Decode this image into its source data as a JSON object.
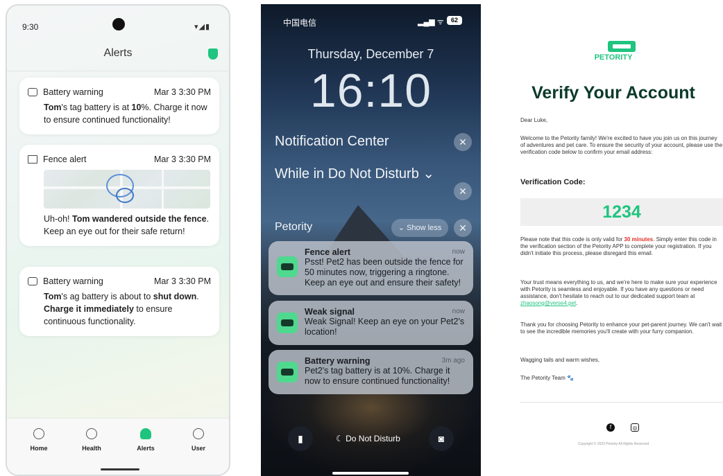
{
  "android": {
    "time": "9:30",
    "title": "Alerts",
    "cards": [
      {
        "title": "Battery warning",
        "date": "Mar 3 3:30 PM",
        "body_html": "<b>Tom</b>'s tag battery is at <b>10</b>%. Charge it now to ensure continued functionality!"
      },
      {
        "title": "Fence alert",
        "date": "Mar 3 3:30 PM",
        "body_html": "Uh-oh! <b>Tom wandered outside the fence</b>. Keep an eye out for their safe return!"
      },
      {
        "title": "Battery warning",
        "date": "Mar 3 3:30 PM",
        "body_html": "<b>Tom</b>'s ag battery is about to <b>shut down</b>. <b>Charge it immediately</b> to ensure continuous functionality."
      }
    ],
    "nav": [
      {
        "label": "Home",
        "icon": "home-icon",
        "active": false
      },
      {
        "label": "Health",
        "icon": "health-icon",
        "active": false
      },
      {
        "label": "Alerts",
        "icon": "bell-icon",
        "active": true
      },
      {
        "label": "User",
        "icon": "user-icon",
        "active": false
      }
    ],
    "accent": "#1fc47f"
  },
  "ios": {
    "carrier": "中国电信",
    "battery": "62",
    "date": "Thursday, December 7",
    "clock": "16:10",
    "notification_center": "Notification Center",
    "dnd_header": "While in Do Not Disturb",
    "app_name": "Petority",
    "show_less": "Show less",
    "notifications": [
      {
        "title": "Fence alert",
        "when": "now",
        "body": "Psst! Pet2 has been outside the fence for 50 minutes now, triggering a ringtone. Keep an eye out and ensure their safety!"
      },
      {
        "title": "Weak signal",
        "when": "now",
        "body": "Weak Signal! Keep an eye on your Pet2's location!"
      },
      {
        "title": "Battery warning",
        "when": "3m ago",
        "body": "Pet2's tag battery is at 10%. Charge it now to ensure continued functionality!"
      }
    ],
    "dnd_label": "Do Not Disturb"
  },
  "email": {
    "brand": "PETORITY",
    "heading": "Verify Your Account",
    "greeting": "Dear Luke,",
    "intro": "Welcome to the Petority family! We're excited to have you join us on this journey of adventures and pet care. To ensure the security of your account, please use the verification code below to confirm your email address:",
    "code_label": "Verification Code:",
    "code": "1234",
    "note_pre": "Please note that this code is only valid for ",
    "note_red": "30 minutes",
    "note_post": ". Simply enter this code in the verification section of the Petority APP to complete your registration. If you didn't initiate this process, please disregard this email.",
    "trust_pre": "Your trust means everything to us, and we're here to make sure your experience with Petority is seamless and enjoyable. If you have any questions or need assistance, don't hesitate to reach out to our dedicated support team at ",
    "trust_link": "zhaosong@verse4.pet",
    "trust_post": ".",
    "thanks": "Thank you for choosing Petority to enhance your pet-parent journey. We can't wait to see the incredible memories you'll create with your furry companion.",
    "signoff": "Wagging tails and warm wishes,",
    "team": "The Petority Team 🐾",
    "copyright": "Copyright © 2023 Petority All Rights Reserved"
  }
}
